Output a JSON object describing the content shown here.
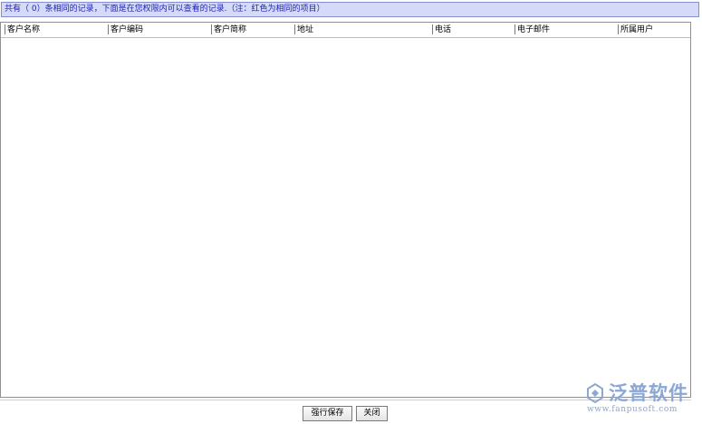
{
  "notice": {
    "text": "共有（ 0）条相同的记录，下面是在您权限内可以查看的记录.（注：红色为相同的项目）"
  },
  "table": {
    "columns": [
      "客户名称",
      "客户编码",
      "客户简称",
      "地址",
      "电话",
      "电子邮件",
      "所属用户"
    ],
    "rows": []
  },
  "buttons": {
    "force_save": "强行保存",
    "close": "关闭"
  },
  "watermark": {
    "title": "泛普软件",
    "url": "www.fanpusoft.com"
  },
  "colors": {
    "notice_bg": "#d4daf8",
    "notice_text": "#2323b4",
    "watermark": "#8aa7d6"
  }
}
